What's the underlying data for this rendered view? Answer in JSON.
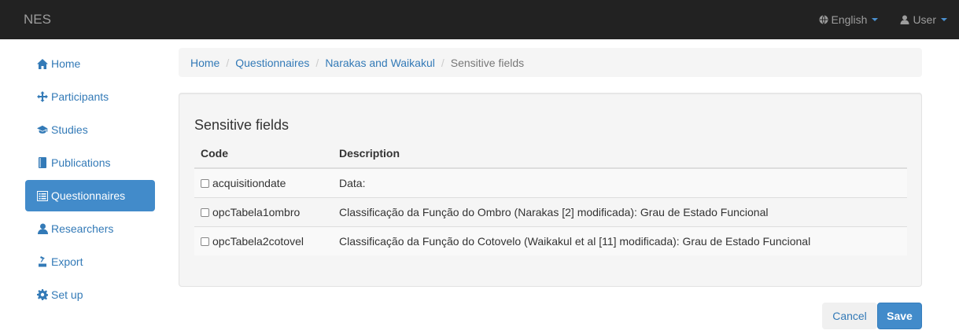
{
  "navbar": {
    "brand": "NES",
    "language": "English",
    "user": "User"
  },
  "sidebar": {
    "items": [
      {
        "label": "Home",
        "icon": "home-icon"
      },
      {
        "label": "Participants",
        "icon": "move-icon"
      },
      {
        "label": "Studies",
        "icon": "graduation-cap-icon"
      },
      {
        "label": "Publications",
        "icon": "book-icon"
      },
      {
        "label": "Questionnaires",
        "icon": "list-alt-icon",
        "active": true
      },
      {
        "label": "Researchers",
        "icon": "user-icon"
      },
      {
        "label": "Export",
        "icon": "export-icon"
      },
      {
        "label": "Set up",
        "icon": "cog-icon"
      }
    ]
  },
  "breadcrumb": {
    "items": [
      "Home",
      "Questionnaires",
      "Narakas and Waikakul"
    ],
    "current": "Sensitive fields"
  },
  "panel": {
    "title": "Sensitive fields",
    "columns": [
      "Code",
      "Description"
    ],
    "rows": [
      {
        "code": "acquisitiondate",
        "description": "Data:",
        "checked": false
      },
      {
        "code": "opcTabela1ombro",
        "description": "Classificação da Função do Ombro (Narakas [2] modificada): Grau de Estado Funcional",
        "checked": false
      },
      {
        "code": "opcTabela2cotovel",
        "description": "Classificação da Função do Cotovelo (Waikakul et al [11] modificada): Grau de Estado Funcional",
        "checked": false
      }
    ]
  },
  "actions": {
    "cancel": "Cancel",
    "save": "Save"
  },
  "colors": {
    "navbar_bg": "#222222",
    "primary": "#428bca",
    "link": "#337ab7"
  }
}
